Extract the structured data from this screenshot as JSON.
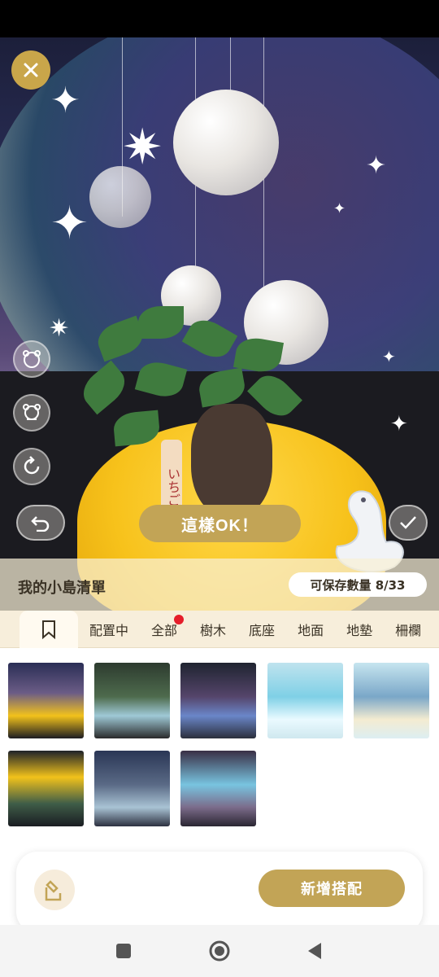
{
  "scene": {
    "sign_text": "いちご",
    "confirm_label": "這樣OK！"
  },
  "list": {
    "title": "我的小島清單",
    "save_count": "可保存數量 8/33"
  },
  "tabs": [
    {
      "label": "配置中"
    },
    {
      "label": "全部",
      "has_notification": true
    },
    {
      "label": "樹木"
    },
    {
      "label": "底座"
    },
    {
      "label": "地面"
    },
    {
      "label": "地墊"
    },
    {
      "label": "柵欄"
    }
  ],
  "bottom": {
    "add_label": "新增搭配"
  },
  "colors": {
    "accent": "#c2a456",
    "notification": "#e51d2a",
    "tab_bg": "#f7eedb"
  },
  "icons": {
    "close": "close-icon",
    "bear_face": "bear-face-icon",
    "bear": "bear-icon",
    "refresh": "refresh-icon",
    "undo": "undo-icon",
    "check": "check-icon",
    "bookmark": "bookmark-icon",
    "export": "export-icon",
    "nav_recent": "square-icon",
    "nav_home": "circle-icon",
    "nav_back": "triangle-back-icon"
  }
}
